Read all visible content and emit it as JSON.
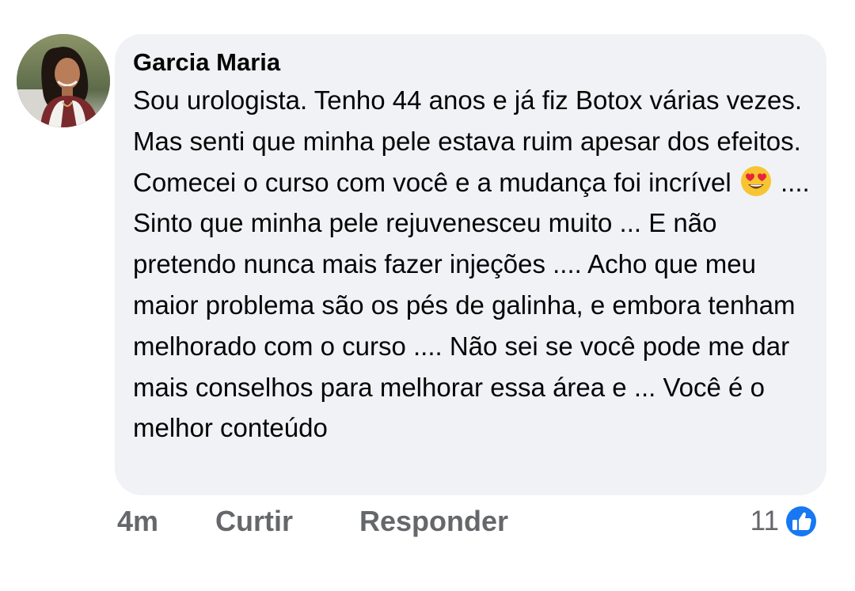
{
  "comment": {
    "author": "Garcia Maria",
    "text_before_emoji": "Sou urologista. Tenho 44 anos e já fiz Botox várias vezes. Mas senti que minha pele estava ruim apesar dos efeitos. Comecei o curso com você e a mudança foi incrível",
    "emoji": "smiling-face-with-heart-eyes",
    "text_after_emoji": ".... Sinto que minha pele rejuvenesceu muito ... E não pretendo nunca mais fazer injeções .... Acho que meu maior problema são os pés de galinha, e embora tenham melhorado com o curso .... Não sei se você pode me dar mais conselhos para melhorar essa área e ... Você é o melhor conteúdo"
  },
  "actions": {
    "time": "4m",
    "like_label": "Curtir",
    "reply_label": "Responder"
  },
  "reactions": {
    "count": "11",
    "icon": "like-thumb-icon",
    "color": "#1877f2"
  },
  "colors": {
    "bubble": "#f0f2f5",
    "text": "#050505",
    "secondary": "#65676b"
  }
}
